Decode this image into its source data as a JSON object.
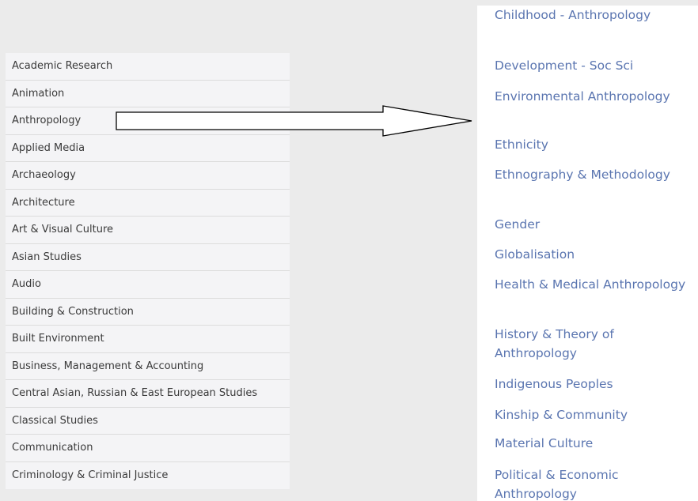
{
  "left_list": {
    "items": [
      {
        "label": "Academic Research"
      },
      {
        "label": "Animation"
      },
      {
        "label": "Anthropology"
      },
      {
        "label": "Applied Media"
      },
      {
        "label": "Archaeology"
      },
      {
        "label": "Architecture"
      },
      {
        "label": "Art & Visual Culture"
      },
      {
        "label": "Asian Studies"
      },
      {
        "label": "Audio"
      },
      {
        "label": "Building & Construction"
      },
      {
        "label": "Built Environment"
      },
      {
        "label": "Business, Management & Accounting"
      },
      {
        "label": "Central Asian, Russian & East European Studies"
      },
      {
        "label": "Classical Studies"
      },
      {
        "label": "Communication"
      },
      {
        "label": "Criminology & Criminal Justice"
      }
    ]
  },
  "right_list": {
    "items": [
      {
        "label": "Childhood - Anthropology"
      },
      {
        "label": "Development - Soc Sci"
      },
      {
        "label": "Environmental Anthropology"
      },
      {
        "label": "Ethnicity"
      },
      {
        "label": "Ethnography & Methodology"
      },
      {
        "label": "Gender"
      },
      {
        "label": "Globalisation"
      },
      {
        "label": "Health & Medical Anthropology"
      },
      {
        "label": "History & Theory of Anthropology"
      },
      {
        "label": "Indigenous Peoples"
      },
      {
        "label": "Kinship & Community"
      },
      {
        "label": "Material Culture"
      },
      {
        "label": "Political & Economic Anthropology"
      }
    ]
  },
  "colors": {
    "page_background": "#ebebeb",
    "left_item_background": "#f4f4f6",
    "left_item_text": "#3a3a3a",
    "right_link_text": "#5a75b0",
    "arrow_stroke": "#000000"
  }
}
